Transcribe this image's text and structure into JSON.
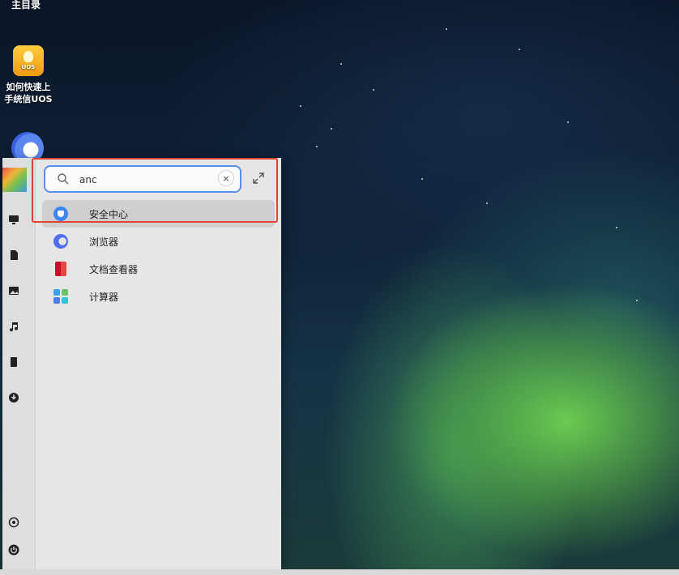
{
  "desktop": {
    "top_label": "主目录",
    "guide_tile_text": "UOS",
    "guide_label_line1": "如何快速上",
    "guide_label_line2": "手统信UOS"
  },
  "launcher": {
    "search": {
      "value": "anc",
      "placeholder": ""
    },
    "results": [
      {
        "label": "安全中心",
        "icon": "security-center-icon",
        "selected": true
      },
      {
        "label": "浏览器",
        "icon": "browser-icon",
        "selected": false
      },
      {
        "label": "文档查看器",
        "icon": "document-viewer-icon",
        "selected": false
      },
      {
        "label": "计算器",
        "icon": "calculator-icon",
        "selected": false
      }
    ],
    "sidebar_icons": [
      "computer-icon",
      "documents-icon",
      "pictures-icon",
      "music-icon",
      "videos-icon",
      "downloads-icon",
      "settings-icon",
      "power-icon"
    ]
  },
  "colors": {
    "highlight": "#e0432f",
    "search_focus": "#5a8ff0",
    "accent": "#3f86f5"
  }
}
